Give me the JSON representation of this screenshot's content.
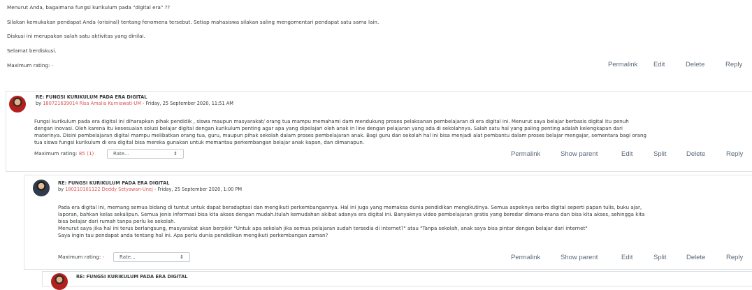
{
  "intro": {
    "lines": [
      "Menurut Anda, bagaimana fungsi kurikulum pada \"digital era\" ??",
      "Silakan kemukakan pendapat Anda (orisinal) tentang fenomena tersebut. Setiap mahasiswa silakan saling mengomentari pendapat satu sama lain.",
      "Diskusi ini merupakan salah satu aktivitas yang dinilai.",
      "Selamat berdiskusi."
    ],
    "rating_label": "Maximum rating: ",
    "rating_value": "-",
    "actions": [
      "Permalink",
      "Edit",
      "Delete",
      "Reply"
    ]
  },
  "posts": [
    {
      "title": "RE: FUNGSI KURIKULUM PADA ERA DIGITAL",
      "by_prefix": "by ",
      "author": "180721639014 Risa Amalia Kurniawati-UM",
      "date": " - Friday, 25 September 2020, 11:51 AM",
      "body": [
        "Fungsi kurikulum pada era digital ini diharapkan pihak pendidik , siswa maupun masyarakat/ orang tua mampu memahami dam mendukung proses pelaksanan pembelajaran di era digital ini. Menurut saya belajar berbasis digital itu penuh",
        "dengan inovasi. Oleh karena itu kesesuaian solusi belajar digital dengan kurikulum penting agar apa yang dipelajari oleh anak in line dengan pelajaran yang ada di sekolahnya. Salah satu hal yang paling penting adalah kelengkapan dari",
        "materinya. Disini pembelajaran digital mampu melibatkan orang tua, guru, maupun pihak sekolah dalam proses pembelajaran anak. Bagi guru dan sekolah hal ini bisa menjadi alat pembantu dalam proses belajar mengajar, sementara bagi orang",
        "tua siswa fungsi kurikulum di era digital bisa mereka gunakan untuk memantau perkembangan belajar anak kapan, dan dimanapun."
      ],
      "rating_label": "Maximum rating: ",
      "rating_value": "85 (1)",
      "select_value": "Rate...",
      "actions": [
        "Permalink",
        "Show parent",
        "Edit",
        "Split",
        "Delete",
        "Reply"
      ]
    },
    {
      "title": "RE: FUNGSI KURIKULUM PADA ERA DIGITAL",
      "by_prefix": "by ",
      "author": "180210101122 Deddy Setyawan-Unej",
      "date": " - Friday, 25 September 2020, 1:00 PM",
      "body": [
        "Pada era digital ini, memang semua bidang di tuntut untuk dapat beradaptasi dan mengikuti perkembangannya. Hal ini juga yang memaksa dunia pendidikan mengikutinya. Semua aspeknya serba digital seperti papan tulis, buku ajar,",
        "laporan, bahkan kelas sekalipun. Semua jenis informasi bisa kita akses dengan mudah.Itulah kemudahan akibat adanya era digital ini. Banyaknya video pembelajaran gratis yang beredar dimana-mana dan bisa kita akses, sehingga kita",
        "bisa belajar dari rumah tanpa perlu ke sekolah.",
        "Menurut saya jika hal ini terus berlangsung, masyarakat akan berpikir \"Untuk apa sekolah jika semua pelajaran sudah tersedia di internet?\" atau \"Tanpa sekolah, anak saya bisa pintar dengan belajar dari internet\"",
        "Saya ingin tau pendapat anda tentang hal ini. Apa perlu dunia pendidikan mengikuti perkembangan zaman?"
      ],
      "rating_label": "Maximum rating: ",
      "rating_value": "-",
      "select_value": "Rate...",
      "actions": [
        "Permalink",
        "Show parent",
        "Edit",
        "Split",
        "Delete",
        "Reply"
      ]
    },
    {
      "title": "RE: FUNGSI KURIKULUM PADA ERA DIGITAL"
    }
  ],
  "icons": {
    "select_caret": "chevron-up-down-icon"
  }
}
